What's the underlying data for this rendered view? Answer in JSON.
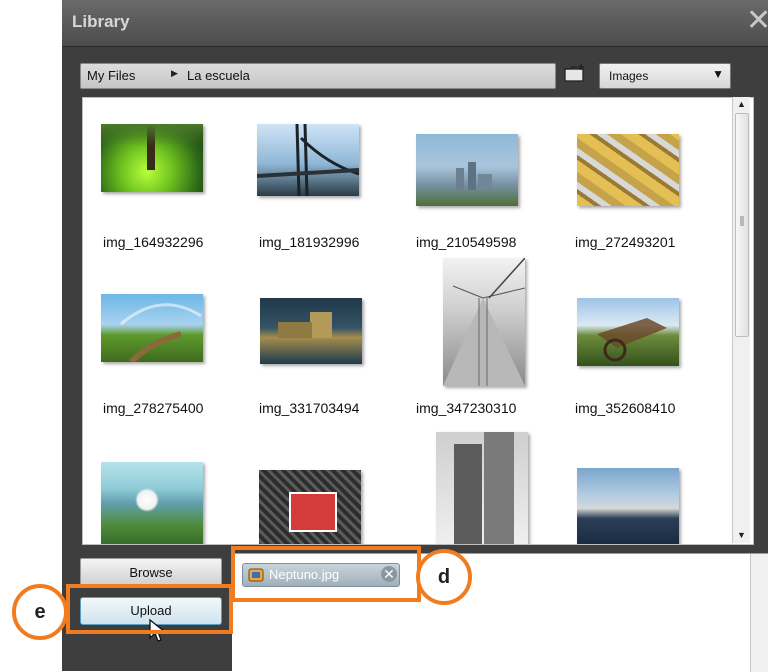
{
  "window": {
    "title": "Library"
  },
  "breadcrumb": {
    "items": [
      "My Files",
      "La escuela"
    ]
  },
  "filter": {
    "selected": "Images"
  },
  "images": [
    "img_164932296",
    "img_181932996",
    "img_210549598",
    "img_272493201",
    "img_278275400",
    "img_331703494",
    "img_347230310",
    "img_352608410"
  ],
  "buttons": {
    "browse": "Browse",
    "upload": "Upload"
  },
  "upload_queue": {
    "file": "Neptuno.jpg"
  },
  "callouts": {
    "d": "d",
    "e": "e"
  },
  "colors": {
    "accent": "#f07c1f",
    "title_bar": "#5a5a5a"
  }
}
